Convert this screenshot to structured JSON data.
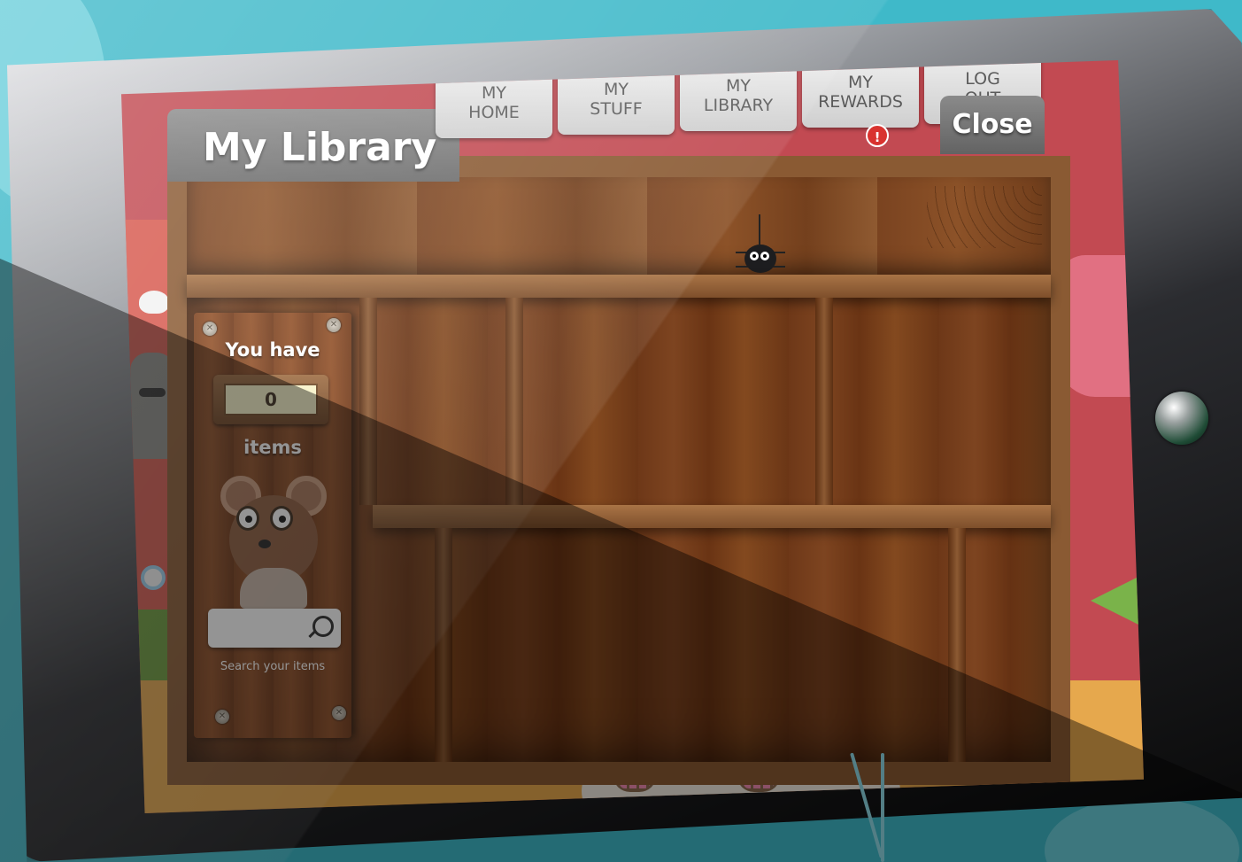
{
  "page": {
    "title": "My Library",
    "close_label": "Close"
  },
  "nav": {
    "tabs": [
      {
        "line1": "MY",
        "line2": "HOME"
      },
      {
        "line1": "MY",
        "line2": "STUFF"
      },
      {
        "line1": "MY",
        "line2": "LIBRARY"
      },
      {
        "line1": "MY",
        "line2": "REWARDS"
      },
      {
        "line1": "LOG",
        "line2": "OUT"
      }
    ],
    "alert_badge": "!"
  },
  "inventory": {
    "you_have_label": "You have",
    "item_count": "0",
    "items_label": "items",
    "search_placeholder": "",
    "search_caption": "Search your items"
  },
  "icons": {
    "search": "search-icon",
    "alert": "alert-icon",
    "spider": "spider-icon",
    "mouse": "mouse-mascot"
  },
  "colors": {
    "screen_background": "#c24a52",
    "tab_gray": "#6b6b6b",
    "wood": "#7a3e1a",
    "alert_red": "#d9332f",
    "count_box": "#f7f2c8"
  }
}
